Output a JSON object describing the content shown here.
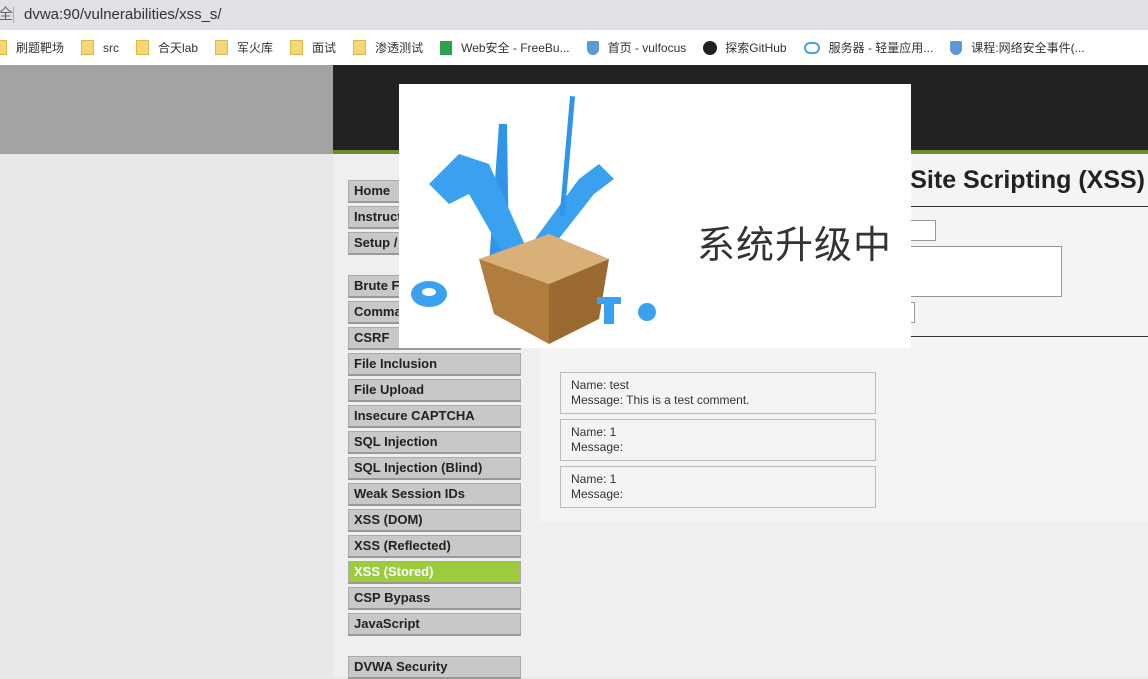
{
  "browser": {
    "security_label": "全",
    "url": "dvwa:90/vulnerabilities/xss_s/"
  },
  "bookmarks": [
    {
      "label": "刷题靶场",
      "icon": "folder-icon"
    },
    {
      "label": "src",
      "icon": "folder-icon"
    },
    {
      "label": "合天lab",
      "icon": "folder-icon"
    },
    {
      "label": "军火库",
      "icon": "folder-icon"
    },
    {
      "label": "面试",
      "icon": "folder-icon"
    },
    {
      "label": "渗透测试",
      "icon": "folder-icon"
    },
    {
      "label": "Web安全 - FreeBu...",
      "icon": "freebuf-icon"
    },
    {
      "label": "首页 - vulfocus",
      "icon": "shield-icon"
    },
    {
      "label": "探索GitHub",
      "icon": "github-icon"
    },
    {
      "label": "服务器 - 轻量应用...",
      "icon": "cloud-icon"
    },
    {
      "label": "课程:网络安全事件(...",
      "icon": "shield-icon"
    }
  ],
  "menu": [
    {
      "label": "Home"
    },
    {
      "label": "Instructions"
    },
    {
      "label": "Setup / Reset DB"
    },
    {
      "label": "Brute Force"
    },
    {
      "label": "Command Injection"
    },
    {
      "label": "CSRF"
    },
    {
      "label": "File Inclusion"
    },
    {
      "label": "File Upload"
    },
    {
      "label": "Insecure CAPTCHA"
    },
    {
      "label": "SQL Injection"
    },
    {
      "label": "SQL Injection (Blind)"
    },
    {
      "label": "Weak Session IDs"
    },
    {
      "label": "XSS (DOM)"
    },
    {
      "label": "XSS (Reflected)"
    },
    {
      "label": "XSS (Stored)",
      "active": true
    },
    {
      "label": "CSP Bypass"
    },
    {
      "label": "JavaScript"
    },
    {
      "label": "DVWA Security"
    }
  ],
  "page_title": "Vulnerability: Stored Cross Site Scripting (XSS)",
  "page_title_visible": "Site Scripting (XSS)",
  "comments": [
    {
      "name": "Name: test",
      "message": "Message: This is a test comment."
    },
    {
      "name": "Name: 1",
      "message": "Message:"
    },
    {
      "name": "Name: 1",
      "message": "Message:"
    }
  ],
  "popup": {
    "text": "系统升级中"
  },
  "colors": {
    "active_menu": "#9ccc3c",
    "header": "#222222",
    "accent_green": "#6a8f2a"
  }
}
